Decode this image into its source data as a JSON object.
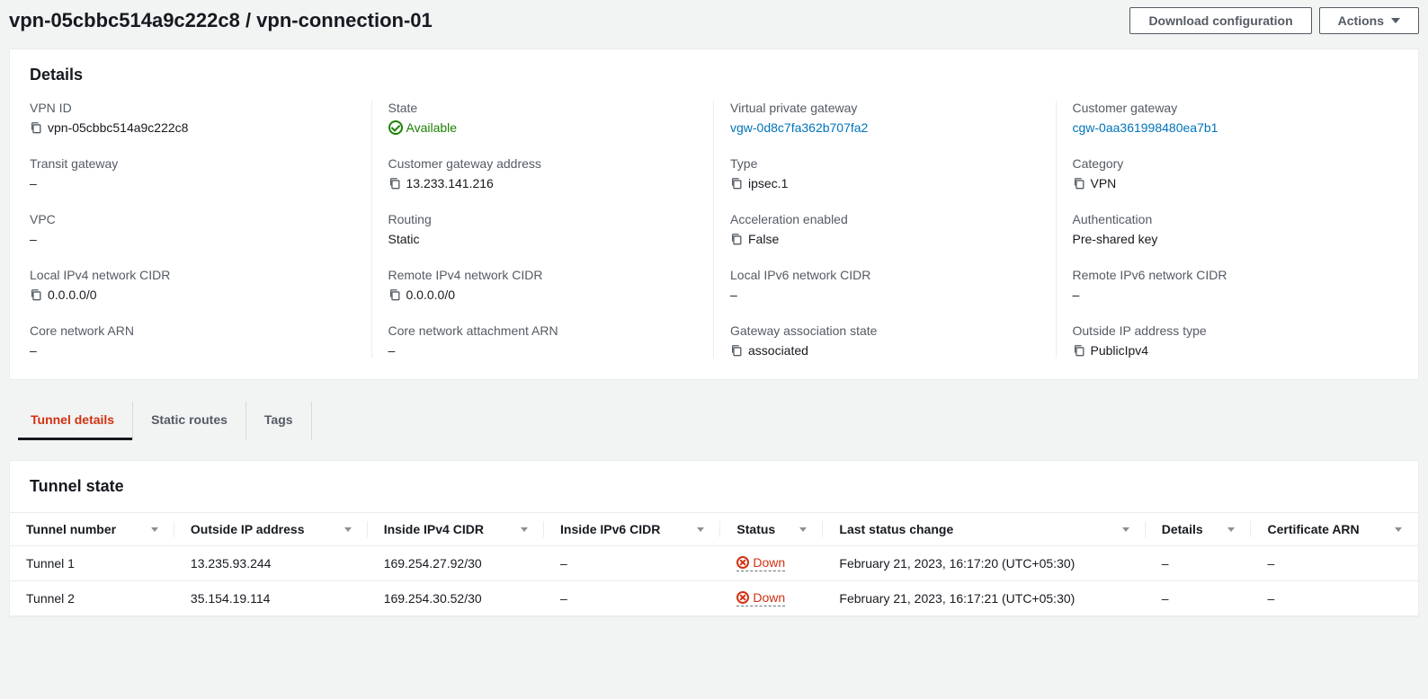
{
  "header": {
    "title": "vpn-05cbbc514a9c222c8 / vpn-connection-01",
    "download_btn": "Download configuration",
    "actions_btn": "Actions"
  },
  "details": {
    "title": "Details",
    "col1": {
      "vpn_id_label": "VPN ID",
      "vpn_id_value": "vpn-05cbbc514a9c222c8",
      "transit_gateway_label": "Transit gateway",
      "transit_gateway_value": "–",
      "vpc_label": "VPC",
      "vpc_value": "–",
      "local_ipv4_cidr_label": "Local IPv4 network CIDR",
      "local_ipv4_cidr_value": "0.0.0.0/0",
      "core_network_arn_label": "Core network ARN",
      "core_network_arn_value": "–"
    },
    "col2": {
      "state_label": "State",
      "state_value": "Available",
      "cgw_address_label": "Customer gateway address",
      "cgw_address_value": "13.233.141.216",
      "routing_label": "Routing",
      "routing_value": "Static",
      "remote_ipv4_cidr_label": "Remote IPv4 network CIDR",
      "remote_ipv4_cidr_value": "0.0.0.0/0",
      "core_network_attachment_arn_label": "Core network attachment ARN",
      "core_network_attachment_arn_value": "–"
    },
    "col3": {
      "vpg_label": "Virtual private gateway",
      "vpg_value": "vgw-0d8c7fa362b707fa2",
      "type_label": "Type",
      "type_value": "ipsec.1",
      "accel_label": "Acceleration enabled",
      "accel_value": "False",
      "local_ipv6_cidr_label": "Local IPv6 network CIDR",
      "local_ipv6_cidr_value": "–",
      "gateway_assoc_label": "Gateway association state",
      "gateway_assoc_value": "associated"
    },
    "col4": {
      "cgw_label": "Customer gateway",
      "cgw_value": "cgw-0aa361998480ea7b1",
      "category_label": "Category",
      "category_value": "VPN",
      "auth_label": "Authentication",
      "auth_value": "Pre-shared key",
      "remote_ipv6_cidr_label": "Remote IPv6 network CIDR",
      "remote_ipv6_cidr_value": "–",
      "outside_ip_type_label": "Outside IP address type",
      "outside_ip_type_value": "PublicIpv4"
    }
  },
  "tabs": {
    "tunnel_details": "Tunnel details",
    "static_routes": "Static routes",
    "tags": "Tags"
  },
  "tunnel": {
    "title": "Tunnel state",
    "headers": {
      "number": "Tunnel number",
      "outside_ip": "Outside IP address",
      "inside_ipv4": "Inside IPv4 CIDR",
      "inside_ipv6": "Inside IPv6 CIDR",
      "status": "Status",
      "last_change": "Last status change",
      "details": "Details",
      "cert_arn": "Certificate ARN"
    },
    "rows": [
      {
        "number": "Tunnel 1",
        "outside_ip": "13.235.93.244",
        "inside_ipv4": "169.254.27.92/30",
        "inside_ipv6": "–",
        "status": "Down",
        "last_change": "February 21, 2023, 16:17:20 (UTC+05:30)",
        "details": "–",
        "cert_arn": "–"
      },
      {
        "number": "Tunnel 2",
        "outside_ip": "35.154.19.114",
        "inside_ipv4": "169.254.30.52/30",
        "inside_ipv6": "–",
        "status": "Down",
        "last_change": "February 21, 2023, 16:17:21 (UTC+05:30)",
        "details": "–",
        "cert_arn": "–"
      }
    ]
  }
}
